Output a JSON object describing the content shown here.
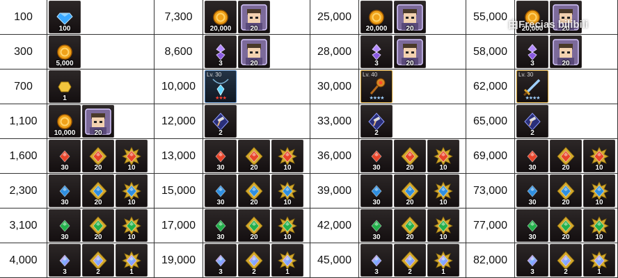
{
  "watermark": "由Frecias bilibili",
  "columns": [
    {
      "rows": [
        {
          "value": "100",
          "items": [
            {
              "icon": "diamond-icon",
              "qty": "100"
            }
          ]
        },
        {
          "value": "300",
          "items": [
            {
              "icon": "gold-coin-icon",
              "qty": "5,000"
            }
          ]
        },
        {
          "value": "700",
          "items": [
            {
              "icon": "gold-nugget-icon",
              "qty": "1"
            }
          ]
        },
        {
          "value": "1,100",
          "items": [
            {
              "icon": "gold-coin-icon",
              "qty": "10,000"
            },
            {
              "icon": "hero-portrait-icon",
              "qty": "20"
            }
          ]
        },
        {
          "value": "1,600",
          "items": [
            {
              "icon": "red-gem-icon",
              "qty": "30"
            },
            {
              "icon": "red-gem-medium-icon",
              "qty": "20"
            },
            {
              "icon": "red-gem-large-icon",
              "qty": "10"
            }
          ]
        },
        {
          "value": "2,300",
          "items": [
            {
              "icon": "blue-gem-icon",
              "qty": "30"
            },
            {
              "icon": "blue-gem-medium-icon",
              "qty": "20"
            },
            {
              "icon": "blue-gem-large-icon",
              "qty": "10"
            }
          ]
        },
        {
          "value": "3,100",
          "items": [
            {
              "icon": "green-gem-icon",
              "qty": "30"
            },
            {
              "icon": "green-gem-medium-icon",
              "qty": "20"
            },
            {
              "icon": "green-gem-large-icon",
              "qty": "10"
            }
          ]
        },
        {
          "value": "4,000",
          "items": [
            {
              "icon": "rainbow-gem-icon",
              "qty": "3"
            },
            {
              "icon": "rainbow-gem-medium-icon",
              "qty": "2"
            },
            {
              "icon": "rainbow-gem-large-icon",
              "qty": "1"
            }
          ]
        }
      ]
    },
    {
      "rows": [
        {
          "value": "7,300",
          "items": [
            {
              "icon": "gold-coin-icon",
              "qty": "20,000"
            },
            {
              "icon": "hero-portrait-icon",
              "qty": "20"
            }
          ]
        },
        {
          "value": "8,600",
          "items": [
            {
              "icon": "purple-crystal-icon",
              "qty": "3"
            },
            {
              "icon": "hero-portrait-icon",
              "qty": "20"
            }
          ]
        },
        {
          "value": "10,000",
          "items": [
            {
              "icon": "pendant-icon",
              "level": "Lv. 30",
              "stars": "★★★",
              "star_color": "red"
            }
          ]
        },
        {
          "value": "12,000",
          "items": [
            {
              "icon": "hammer-scroll-icon",
              "qty": "2"
            }
          ]
        },
        {
          "value": "13,000",
          "items": [
            {
              "icon": "red-gem-icon",
              "qty": "30"
            },
            {
              "icon": "red-gem-medium-icon",
              "qty": "20"
            },
            {
              "icon": "red-gem-large-icon",
              "qty": "10"
            }
          ]
        },
        {
          "value": "15,000",
          "items": [
            {
              "icon": "blue-gem-icon",
              "qty": "30"
            },
            {
              "icon": "blue-gem-medium-icon",
              "qty": "20"
            },
            {
              "icon": "blue-gem-large-icon",
              "qty": "10"
            }
          ]
        },
        {
          "value": "17,000",
          "items": [
            {
              "icon": "green-gem-icon",
              "qty": "30"
            },
            {
              "icon": "green-gem-medium-icon",
              "qty": "20"
            },
            {
              "icon": "green-gem-large-icon",
              "qty": "10"
            }
          ]
        },
        {
          "value": "19,000",
          "items": [
            {
              "icon": "rainbow-gem-icon",
              "qty": "3"
            },
            {
              "icon": "rainbow-gem-medium-icon",
              "qty": "2"
            },
            {
              "icon": "rainbow-gem-large-icon",
              "qty": "1"
            }
          ]
        }
      ]
    },
    {
      "rows": [
        {
          "value": "25,000",
          "items": [
            {
              "icon": "gold-coin-icon",
              "qty": "20,000"
            },
            {
              "icon": "hero-portrait-icon",
              "qty": "20"
            }
          ]
        },
        {
          "value": "28,000",
          "items": [
            {
              "icon": "purple-crystal-icon",
              "qty": "3"
            },
            {
              "icon": "hero-portrait-icon",
              "qty": "20"
            }
          ]
        },
        {
          "value": "30,000",
          "items": [
            {
              "icon": "scepter-icon",
              "level": "Lv. 40",
              "stars": "★★★★",
              "star_color": "blue"
            }
          ]
        },
        {
          "value": "33,000",
          "items": [
            {
              "icon": "hammer-scroll-icon",
              "qty": "2"
            }
          ]
        },
        {
          "value": "36,000",
          "items": [
            {
              "icon": "red-gem-icon",
              "qty": "30"
            },
            {
              "icon": "red-gem-medium-icon",
              "qty": "20"
            },
            {
              "icon": "red-gem-large-icon",
              "qty": "10"
            }
          ]
        },
        {
          "value": "39,000",
          "items": [
            {
              "icon": "blue-gem-icon",
              "qty": "30"
            },
            {
              "icon": "blue-gem-medium-icon",
              "qty": "20"
            },
            {
              "icon": "blue-gem-large-icon",
              "qty": "10"
            }
          ]
        },
        {
          "value": "42,000",
          "items": [
            {
              "icon": "green-gem-icon",
              "qty": "30"
            },
            {
              "icon": "green-gem-medium-icon",
              "qty": "20"
            },
            {
              "icon": "green-gem-large-icon",
              "qty": "10"
            }
          ]
        },
        {
          "value": "45,000",
          "items": [
            {
              "icon": "rainbow-gem-icon",
              "qty": "3"
            },
            {
              "icon": "rainbow-gem-medium-icon",
              "qty": "2"
            },
            {
              "icon": "rainbow-gem-large-icon",
              "qty": "1"
            }
          ]
        }
      ]
    },
    {
      "rows": [
        {
          "value": "55,000",
          "items": [
            {
              "icon": "gold-coin-icon",
              "qty": "20,000"
            },
            {
              "icon": "hero-portrait-icon",
              "qty": "20"
            }
          ]
        },
        {
          "value": "58,000",
          "items": [
            {
              "icon": "purple-crystal-icon",
              "qty": "3"
            },
            {
              "icon": "hero-portrait-icon",
              "qty": "20"
            }
          ]
        },
        {
          "value": "62,000",
          "items": [
            {
              "icon": "sword-icon",
              "level": "Lv. 30",
              "stars": "★★★★",
              "star_color": "blue"
            }
          ]
        },
        {
          "value": "65,000",
          "items": [
            {
              "icon": "hammer-scroll-icon",
              "qty": "2"
            }
          ]
        },
        {
          "value": "69,000",
          "items": [
            {
              "icon": "red-gem-icon",
              "qty": "30"
            },
            {
              "icon": "red-gem-medium-icon",
              "qty": "20"
            },
            {
              "icon": "red-gem-large-icon",
              "qty": "10"
            }
          ]
        },
        {
          "value": "73,000",
          "items": [
            {
              "icon": "blue-gem-icon",
              "qty": "30"
            },
            {
              "icon": "blue-gem-medium-icon",
              "qty": "20"
            },
            {
              "icon": "blue-gem-large-icon",
              "qty": "10"
            }
          ]
        },
        {
          "value": "77,000",
          "items": [
            {
              "icon": "green-gem-icon",
              "qty": "30"
            },
            {
              "icon": "green-gem-medium-icon",
              "qty": "20"
            },
            {
              "icon": "green-gem-large-icon",
              "qty": "10"
            }
          ]
        },
        {
          "value": "82,000",
          "items": [
            {
              "icon": "rainbow-gem-icon",
              "qty": "3"
            },
            {
              "icon": "rainbow-gem-medium-icon",
              "qty": "2"
            },
            {
              "icon": "rainbow-gem-large-icon",
              "qty": "1"
            }
          ]
        }
      ]
    }
  ],
  "colors": {
    "red": "#e8442a",
    "blue": "#2f8fe0",
    "green": "#22b04a",
    "gold": "#e0a21c",
    "purple": "#a06ce0"
  }
}
